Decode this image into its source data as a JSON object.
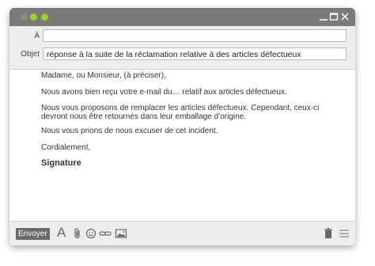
{
  "window": {
    "controls": [
      "minimize-icon",
      "maximize-icon",
      "close-icon"
    ],
    "dots": [
      "gray",
      "green",
      "green"
    ]
  },
  "header": {
    "to_label": "À",
    "to_value": "",
    "subject_label": "Objet",
    "subject_value": "réponse à la suite de la réclamation relative à des articles défectueux"
  },
  "body": {
    "greeting": "Madame, ou Monsieur, (à préciser),",
    "para1": "Nous avons bien reçu votre e-mail  du… relatif aux articles défectueux.",
    "para2_line1": "Nous vous proposons de remplacer les articles défectueux. Cependant, ceux-ci",
    "para2_line2": "devront nous être retournés dans leur emballage d’origine.",
    "para3": "Nous vous prions de nous excuser de cet incident.",
    "closing": "Cordialement,",
    "signature": "Signature"
  },
  "toolbar": {
    "send_label": "Envoyer",
    "font_glyph": "A",
    "icons": [
      "font-icon",
      "attach-icon",
      "emoji-icon",
      "link-icon",
      "image-icon",
      "trash-icon",
      "menu-icon"
    ]
  },
  "colors": {
    "titlebar": "#7a7a7a",
    "dot_green": "#9bd02e",
    "send_button": "#6b6b6b",
    "header_bg": "#eeeeee"
  }
}
